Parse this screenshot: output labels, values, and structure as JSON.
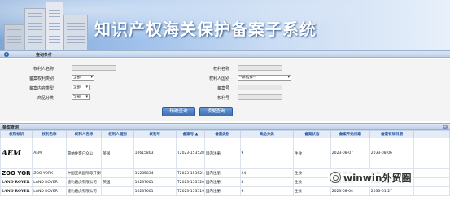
{
  "header": {
    "title": "知识产权海关保护备案子系统"
  },
  "search_panel": {
    "title": "查询条件",
    "fields": {
      "rights_holder_name": {
        "label": "权利人名称",
        "value": ""
      },
      "rights_name": {
        "label": "权利名称",
        "value": ""
      },
      "filing_rights_type": {
        "label": "备案权利类别",
        "value": "全部"
      },
      "holder_nationality": {
        "label": "权利人国别",
        "value": "--请选择--"
      },
      "filing_content_type": {
        "label": "备案内容类型",
        "value": "全部"
      },
      "filing_number": {
        "label": "备案号",
        "value": ""
      },
      "product_category": {
        "label": "商品分类",
        "value": "全部"
      },
      "rights_number": {
        "label": "权利号",
        "value": ""
      }
    },
    "buttons": {
      "precise_query": "精确查询",
      "fuzzy_query": "模糊查询"
    }
  },
  "results": {
    "title": "备案查询",
    "columns": [
      "权利标识",
      "权利名称",
      "权利人名称",
      "权利人国别",
      "权利号",
      "备案号 ▲",
      "备案类别",
      "商品分类",
      "备案状态",
      "备案开始日期",
      "备案有效日期"
    ],
    "rows": [
      {
        "logo": "AEM",
        "name": "AEM",
        "holder": "雷纳件客户众公",
        "country": "英国",
        "rights_no": "10615803",
        "filing_no": "T2023-153528",
        "type": "国内注册",
        "category": "9",
        "status": "生效",
        "start": "2023-08-07",
        "end": "2033-08-06"
      },
      {
        "logo": "ZOO YOR",
        "name": "ZOO YORK",
        "holder": "中国宜尚国际际开蒙鲜动",
        "country": "",
        "rights_no": "35285834",
        "filing_no": "T2023-153521",
        "type": "国内注册",
        "category": "24",
        "status": "生效",
        "start": "2023-08-06",
        "end": "2030-03-06"
      },
      {
        "logo": "LAND ROVER",
        "name": "LAND ROVER",
        "holder": "捷豹路虎有限公司",
        "country": "英国",
        "rights_no": "10237601",
        "filing_no": "T2023-153520",
        "type": "国内注册",
        "category": "8",
        "status": "生效",
        "start": "2023-08-04",
        "end": "2033-01-27"
      },
      {
        "logo": "LAND ROVER",
        "name": "LAND ROVER",
        "holder": "捷豹路虎有限公司",
        "country": "",
        "rights_no": "10237601",
        "filing_no": "T2023-153519",
        "type": "国内注册",
        "category": "9",
        "status": "生效",
        "start": "2023-08-04",
        "end": "2033-01-27"
      }
    ]
  },
  "watermark": {
    "text": "winwin外贸圈"
  }
}
